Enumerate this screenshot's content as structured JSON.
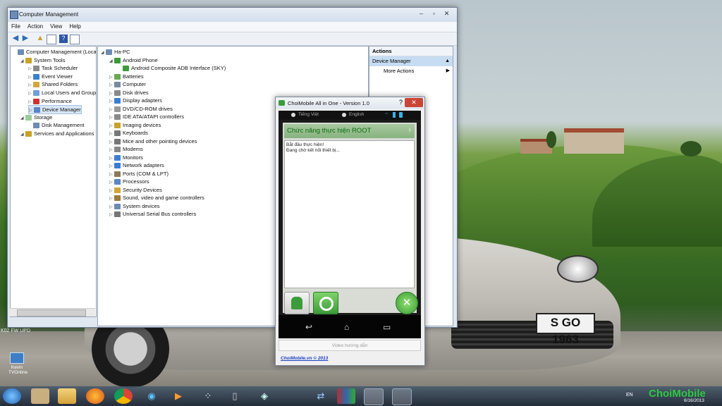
{
  "desktop": {
    "plate_text": "S GO 1963",
    "left_label": "K02 FW UPD",
    "icon_label": "Kevin TVOnline"
  },
  "computer_management": {
    "title": "Computer Management",
    "menu": [
      "File",
      "Action",
      "View",
      "Help"
    ],
    "tree": [
      {
        "label": "Computer Management (Local",
        "indent": 0
      },
      {
        "label": "System Tools",
        "indent": 1
      },
      {
        "label": "Task Scheduler",
        "indent": 2
      },
      {
        "label": "Event Viewer",
        "indent": 2
      },
      {
        "label": "Shared Folders",
        "indent": 2
      },
      {
        "label": "Local Users and Groups",
        "indent": 2
      },
      {
        "label": "Performance",
        "indent": 2
      },
      {
        "label": "Device Manager",
        "indent": 2,
        "selected": true
      },
      {
        "label": "Storage",
        "indent": 1
      },
      {
        "label": "Disk Management",
        "indent": 2
      },
      {
        "label": "Services and Applications",
        "indent": 1
      }
    ],
    "devices": [
      {
        "label": "Ha-PC",
        "indent": 0
      },
      {
        "label": "Android Phone",
        "indent": 1
      },
      {
        "label": "Android Composite ADB Interface (SKY)",
        "indent": 2
      },
      {
        "label": "Batteries",
        "indent": 1
      },
      {
        "label": "Computer",
        "indent": 1
      },
      {
        "label": "Disk drives",
        "indent": 1
      },
      {
        "label": "Display adapters",
        "indent": 1
      },
      {
        "label": "DVD/CD-ROM drives",
        "indent": 1
      },
      {
        "label": "IDE ATA/ATAPI controllers",
        "indent": 1
      },
      {
        "label": "Imaging devices",
        "indent": 1
      },
      {
        "label": "Keyboards",
        "indent": 1
      },
      {
        "label": "Mice and other pointing devices",
        "indent": 1
      },
      {
        "label": "Modems",
        "indent": 1
      },
      {
        "label": "Monitors",
        "indent": 1
      },
      {
        "label": "Network adapters",
        "indent": 1
      },
      {
        "label": "Ports (COM & LPT)",
        "indent": 1
      },
      {
        "label": "Processors",
        "indent": 1
      },
      {
        "label": "Security Devices",
        "indent": 1
      },
      {
        "label": "Sound, video and game controllers",
        "indent": 1
      },
      {
        "label": "System devices",
        "indent": 1
      },
      {
        "label": "Universal Serial Bus controllers",
        "indent": 1
      }
    ],
    "actions": {
      "header": "Actions",
      "section": "Device Manager",
      "more": "More Actions"
    }
  },
  "choimobile": {
    "title": "ChoiMobile All in One - Version 1.0",
    "lang_vi": "Tiếng Việt",
    "lang_en": "English",
    "panel_title": "Chức năng thực hiện ROOT",
    "log": [
      "Bắt đầu thực hiện!",
      "Đang chờ kết nối thiết bị..."
    ],
    "video_button": "Video hướng dẫn",
    "footer_link": "ChoiMobile.vn © 2013"
  },
  "taskbar": {
    "language": "EN",
    "date": "6/16/2013",
    "watermark": "ChoiMobile"
  },
  "colors": {
    "accent_green": "#0a6b10",
    "selection": "#c6dcf2",
    "close_red": "#c94536"
  }
}
